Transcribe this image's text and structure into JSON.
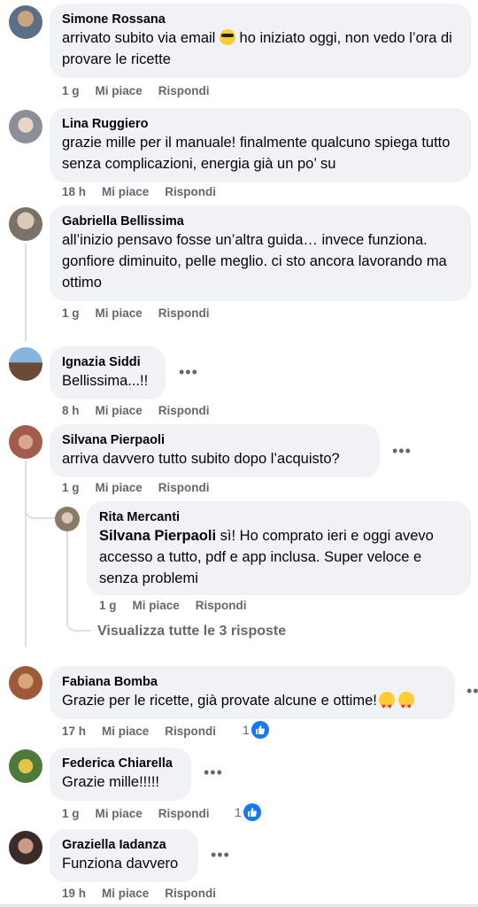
{
  "comments": [
    {
      "name": "Simone Rossana",
      "text_a": "arrivato subito via email",
      "text_b": "ho iniziato oggi, non vedo l’ora di provare le ricette",
      "time": "1 g",
      "like": "Mi piace",
      "reply": "Rispondi"
    },
    {
      "name": "Lina Ruggiero",
      "text": "grazie mille per il manuale! finalmente qualcuno spiega tutto senza complicazioni, energia già un po’ su",
      "time": "18 h",
      "like": "Mi piace",
      "reply": "Rispondi"
    },
    {
      "name": "Gabriella Bellissima",
      "text": "all’inizio pensavo fosse un’altra guida… invece funziona. gonfiore diminuito, pelle meglio. ci sto ancora lavorando ma ottimo",
      "time": "1 g",
      "like": "Mi piace",
      "reply": "Rispondi"
    },
    {
      "name": "Ignazia Siddi",
      "text": "Bellissima...!!",
      "time": "8 h",
      "like": "Mi piace",
      "reply": "Rispondi"
    },
    {
      "name": "Silvana Pierpaoli",
      "text": "arriva davvero tutto subito dopo l’acquisto?",
      "time": "1 g",
      "like": "Mi piace",
      "reply": "Rispondi",
      "reply_comment": {
        "name": "Rita Mercanti",
        "mention": "Silvana Pierpaoli",
        "text": "sì! Ho comprato ieri e oggi avevo accesso a tutto, pdf e app inclusa. Super veloce e senza problemi",
        "time": "1 g",
        "like": "Mi piace",
        "reply": "Rispondi"
      },
      "view_all": "Visualizza tutte le 3 risposte"
    },
    {
      "name": "Fabiana Bomba",
      "text": "Grazie per le ricette, già provate alcune e ottime!",
      "time": "17 h",
      "like": "Mi piace",
      "reply": "Rispondi",
      "likes": "1"
    },
    {
      "name": "Federica Chiarella",
      "text": "Grazie mille!!!!!",
      "time": "1 g",
      "like": "Mi piace",
      "reply": "Rispondi",
      "likes": "1"
    },
    {
      "name": "Graziella Iadanza",
      "text": "Funziona davvero",
      "time": "19 h",
      "like": "Mi piace",
      "reply": "Rispondi"
    }
  ],
  "more_icon": "more-dots-icon",
  "like_icon": "thumbs-up-icon",
  "colors": {
    "bubble": "#f0f2f5",
    "meta": "#65676b",
    "like_blue": "#1877f2"
  }
}
